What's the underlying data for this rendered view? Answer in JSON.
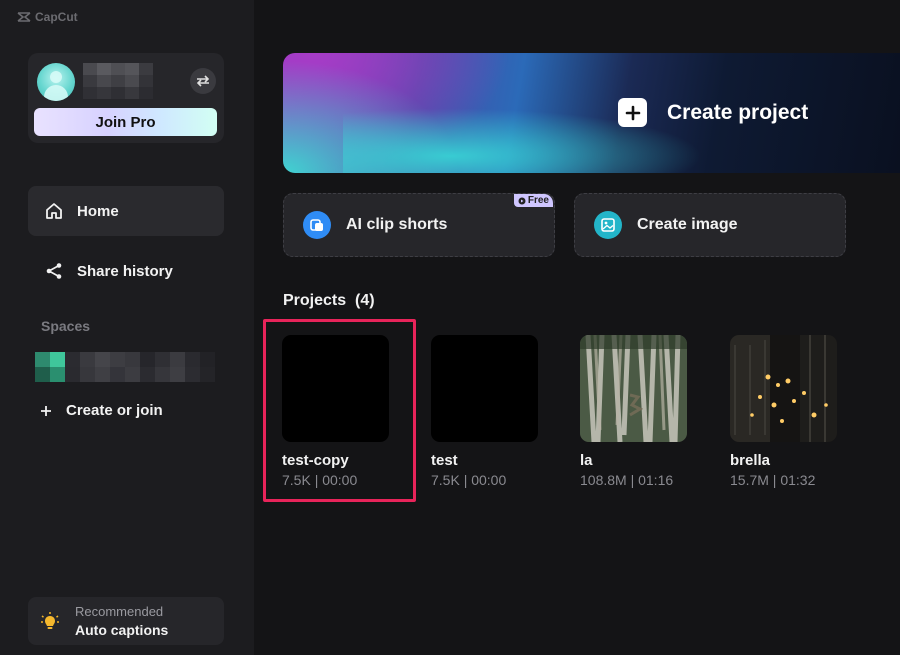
{
  "app": {
    "name": "CapCut"
  },
  "account": {
    "join_pro_label": "Join Pro"
  },
  "sidebar": {
    "items": [
      {
        "label": "Home",
        "icon": "home-icon"
      },
      {
        "label": "Share history",
        "icon": "share-icon"
      }
    ],
    "spaces_label": "Spaces",
    "create_or_join": "Create or join",
    "recommended": {
      "caption": "Recommended",
      "title": "Auto captions",
      "icon": "lightbulb-icon"
    }
  },
  "main": {
    "create_project": "Create project",
    "tools": [
      {
        "label": "AI clip shorts",
        "badge": "Free",
        "icon": "ai-clip-icon"
      },
      {
        "label": "Create image",
        "icon": "image-icon"
      }
    ],
    "projects_label": "Projects",
    "projects_count": "(4)",
    "projects": [
      {
        "name": "test-copy",
        "meta": "7.5K | 00:00"
      },
      {
        "name": "test",
        "meta": "7.5K | 00:00"
      },
      {
        "name": "la",
        "meta": "108.8M | 01:16"
      },
      {
        "name": "brella",
        "meta": "15.7M | 01:32"
      }
    ]
  },
  "colors": {
    "sidebar_bg": "#1c1c1f",
    "main_bg": "#141416",
    "highlight": "#e8245a",
    "ai_icon": "#2f8cf5",
    "image_icon": "#23b5c9"
  }
}
